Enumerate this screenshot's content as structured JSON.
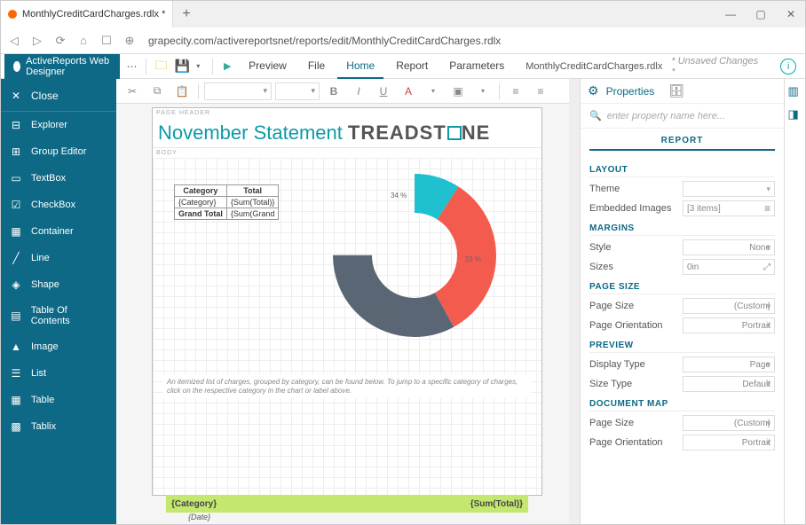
{
  "browser": {
    "tab_title": "MonthlyCreditCardCharges.rdlx *",
    "url": "grapecity.com/activereportsnet/reports/edit/MonthlyCreditCardCharges.rdlx"
  },
  "app": {
    "brand": "ActiveReports Web Designer",
    "preview": "Preview",
    "menus": [
      "File",
      "Home",
      "Report",
      "Parameters"
    ],
    "active_menu": "Home",
    "doc_name": "MonthlyCreditCardCharges.rdlx",
    "unsaved": "* Unsaved Changes *"
  },
  "sidebar": {
    "close": "Close",
    "items": [
      {
        "icon": "tree-icon",
        "label": "Explorer"
      },
      {
        "icon": "group-icon",
        "label": "Group Editor"
      },
      {
        "icon": "textbox-icon",
        "label": "TextBox"
      },
      {
        "icon": "checkbox-icon",
        "label": "CheckBox"
      },
      {
        "icon": "container-icon",
        "label": "Container"
      },
      {
        "icon": "line-icon",
        "label": "Line"
      },
      {
        "icon": "shape-icon",
        "label": "Shape"
      },
      {
        "icon": "toc-icon",
        "label": "Table Of Contents"
      },
      {
        "icon": "image-icon",
        "label": "Image"
      },
      {
        "icon": "list-icon",
        "label": "List"
      },
      {
        "icon": "table-icon",
        "label": "Table"
      },
      {
        "icon": "tablix-icon",
        "label": "Tablix"
      }
    ]
  },
  "report": {
    "page_header_label": "PAGE HEADER",
    "body_label": "BODY",
    "title": "November Statement",
    "logo": "TREADSTONE",
    "table": {
      "h1": "Category",
      "h2": "Total",
      "r1c1": "{Category}",
      "r1c2": "{Sum(Total)}",
      "r2c1": "Grand Total",
      "r2c2": "{Sum(Grand"
    },
    "note": "An itemized list of charges, grouped by category, can be found below. To jump to a specific category of charges, click on the respective category in the chart or label above.",
    "band_left": "{Category}",
    "band_right": "{Sum(Total)}",
    "date_row": "{Date}"
  },
  "chart_data": {
    "type": "pie",
    "slices": [
      {
        "label": "34 %",
        "value": 34,
        "color": "#1fc0cf"
      },
      {
        "label": "33 %",
        "value": 33,
        "color": "#f45b4f"
      },
      {
        "label": "33 %",
        "value": 33,
        "color": "#5b6675"
      }
    ]
  },
  "properties": {
    "panel_title": "Properties",
    "search_placeholder": "enter property name here...",
    "category": "REPORT",
    "sections": [
      {
        "title": "LAYOUT",
        "rows": [
          {
            "label": "Theme",
            "value": "<Empty>",
            "kind": "dd"
          },
          {
            "label": "Embedded Images",
            "value": "[3 items]",
            "kind": "ls"
          }
        ]
      },
      {
        "title": "MARGINS",
        "rows": [
          {
            "label": "Style",
            "value": "None",
            "kind": "dd"
          },
          {
            "label": "Sizes",
            "value": "0in",
            "kind": "exp"
          }
        ]
      },
      {
        "title": "PAGE SIZE",
        "rows": [
          {
            "label": "Page Size",
            "value": "(Custom)",
            "kind": "dd"
          },
          {
            "label": "Page Orientation",
            "value": "Portrait",
            "kind": "dd"
          }
        ]
      },
      {
        "title": "PREVIEW",
        "rows": [
          {
            "label": "Display Type",
            "value": "Page",
            "kind": "dd"
          },
          {
            "label": "Size Type",
            "value": "Default",
            "kind": "dd"
          }
        ]
      },
      {
        "title": "DOCUMENT MAP",
        "rows": [
          {
            "label": "Page Size",
            "value": "(Custom)",
            "kind": "dd"
          },
          {
            "label": "Page Orientation",
            "value": "Portrait",
            "kind": "dd"
          }
        ]
      }
    ]
  }
}
